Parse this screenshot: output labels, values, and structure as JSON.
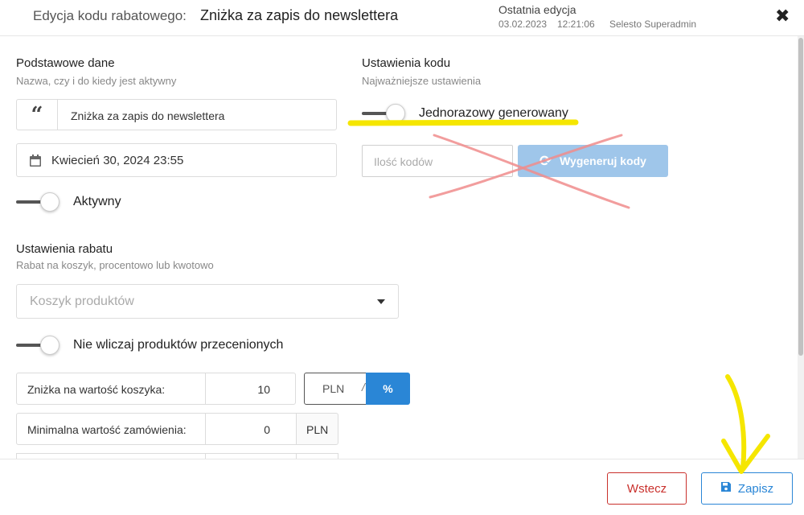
{
  "header": {
    "label": "Edycja kodu rabatowego:",
    "name": "Zniżka za zapis do newslettera",
    "last_edit_label": "Ostatnia edycja",
    "last_edit_date": "03.02.2023",
    "last_edit_time": "12:21:06",
    "last_edit_user": "Selesto Superadmin",
    "close_glyph": "✖"
  },
  "basic": {
    "title": "Podstawowe dane",
    "subtitle": "Nazwa, czy i do kiedy jest aktywny",
    "name_value": "Zniżka za zapis do newslettera",
    "date_value": "Kwiecień 30, 2024 23:55",
    "active_label": "Aktywny"
  },
  "code_settings": {
    "title": "Ustawienia kodu",
    "subtitle": "Najważniejsze ustawienia",
    "single_use_label": "Jednorazowy generowany",
    "count_placeholder": "Ilość kodów",
    "generate_label": "Wygeneruj kody"
  },
  "discount": {
    "title": "Ustawienia rabatu",
    "subtitle": "Rabat na koszyk, procentowo lub kwotowo",
    "scope_placeholder": "Koszyk produktów",
    "exclude_label": "Nie wliczaj produktów przecenionych",
    "cart_discount_label": "Zniżka na wartość koszyka:",
    "cart_discount_value": "10",
    "unit_pln": "PLN",
    "unit_slash": "/",
    "unit_pct": "%",
    "min_order_label": "Minimalna wartość zamówienia:",
    "min_order_value": "0",
    "min_order_unit": "PLN"
  },
  "footer": {
    "back_label": "Wstecz",
    "save_label": "Zapisz"
  },
  "colors": {
    "accent": "#2a86d6",
    "danger": "#c9302c",
    "highlight": "#f5e600",
    "cross": "#f08c8c"
  }
}
